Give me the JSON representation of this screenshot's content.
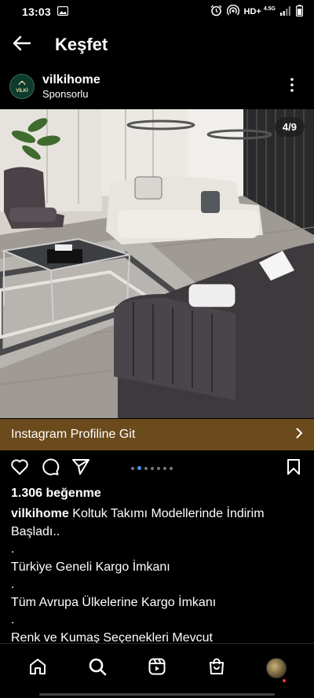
{
  "status_bar": {
    "time": "13:03",
    "network": "HD+",
    "network_type": "4.5G",
    "icons": [
      "image-icon",
      "alarm-icon",
      "hotspot-icon",
      "signal-icon",
      "battery-icon"
    ]
  },
  "header": {
    "title": "Keşfet",
    "back_icon": "arrow-left-icon"
  },
  "post": {
    "username": "vilkihome",
    "sponsored_label": "Sponsorlu",
    "avatar_text": "VİLKİ",
    "more_icon": "more-vertical-icon"
  },
  "media": {
    "counter": "4/9",
    "description_icon": "living-room-photo"
  },
  "cta": {
    "label": "Instagram Profiline Git",
    "color": "#6b4a1c"
  },
  "carousel": {
    "total": 7,
    "active_index": 1,
    "active_color": "#3897f0"
  },
  "engagement": {
    "likes": "1.306 beğenme"
  },
  "caption": {
    "user": "vilkihome",
    "text": "Koltuk Takımı Modellerinde İndirim Başladı..",
    "lines": [
      ".",
      "Türkiye Geneli Kargo İmkanı",
      ".",
      "Tüm Avrupa Ülkelerine Kargo İmkanı",
      ".",
      "Renk ve Kumaş Seçenekleri Mevcut"
    ]
  },
  "bottom_nav": {
    "items": [
      "home-icon",
      "search-icon",
      "reels-icon",
      "shop-icon",
      "profile-avatar"
    ]
  }
}
